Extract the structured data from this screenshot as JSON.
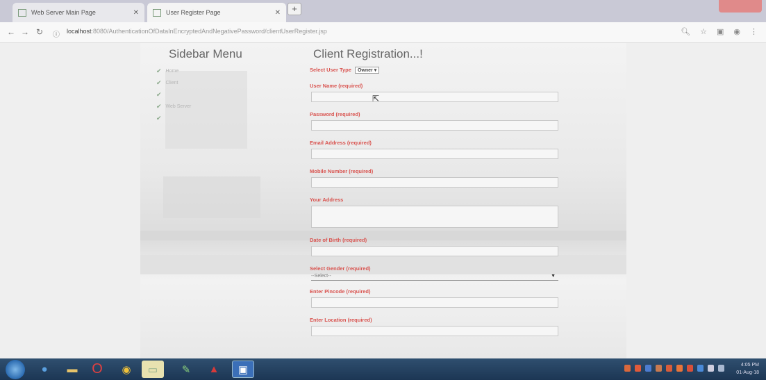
{
  "browser": {
    "tabs": [
      {
        "title": "Web Server Main Page"
      },
      {
        "title": "User Register Page"
      }
    ],
    "url_host": "localhost",
    "url_path": ":8080/AuthenticationOfDataInEncryptedAndNegativePassword/clientUserRegister.jsp"
  },
  "sidebar": {
    "title": "Sidebar Menu",
    "items": [
      {
        "label": "Home"
      },
      {
        "label": "Client"
      },
      {
        "label": ""
      },
      {
        "label": "Web Server"
      },
      {
        "label": ""
      }
    ]
  },
  "form": {
    "title": "Client Registration...!",
    "user_type_label": "Select User Type",
    "user_type_value": "Owner",
    "fields": [
      {
        "label": "User Name (required)"
      },
      {
        "label": "Password (required)"
      },
      {
        "label": "Email Address (required)"
      },
      {
        "label": "Mobile Number (required)"
      },
      {
        "label": "Your Address"
      },
      {
        "label": "Date of Birth (required)"
      }
    ],
    "gender_label": "Select Gender (required)",
    "gender_value": "--Select--",
    "pincode_label": "Enter Pincode (required)",
    "location_label": "Enter Location (required)"
  },
  "taskbar": {
    "time": "4:05 PM",
    "date": "01-Aug-18"
  }
}
